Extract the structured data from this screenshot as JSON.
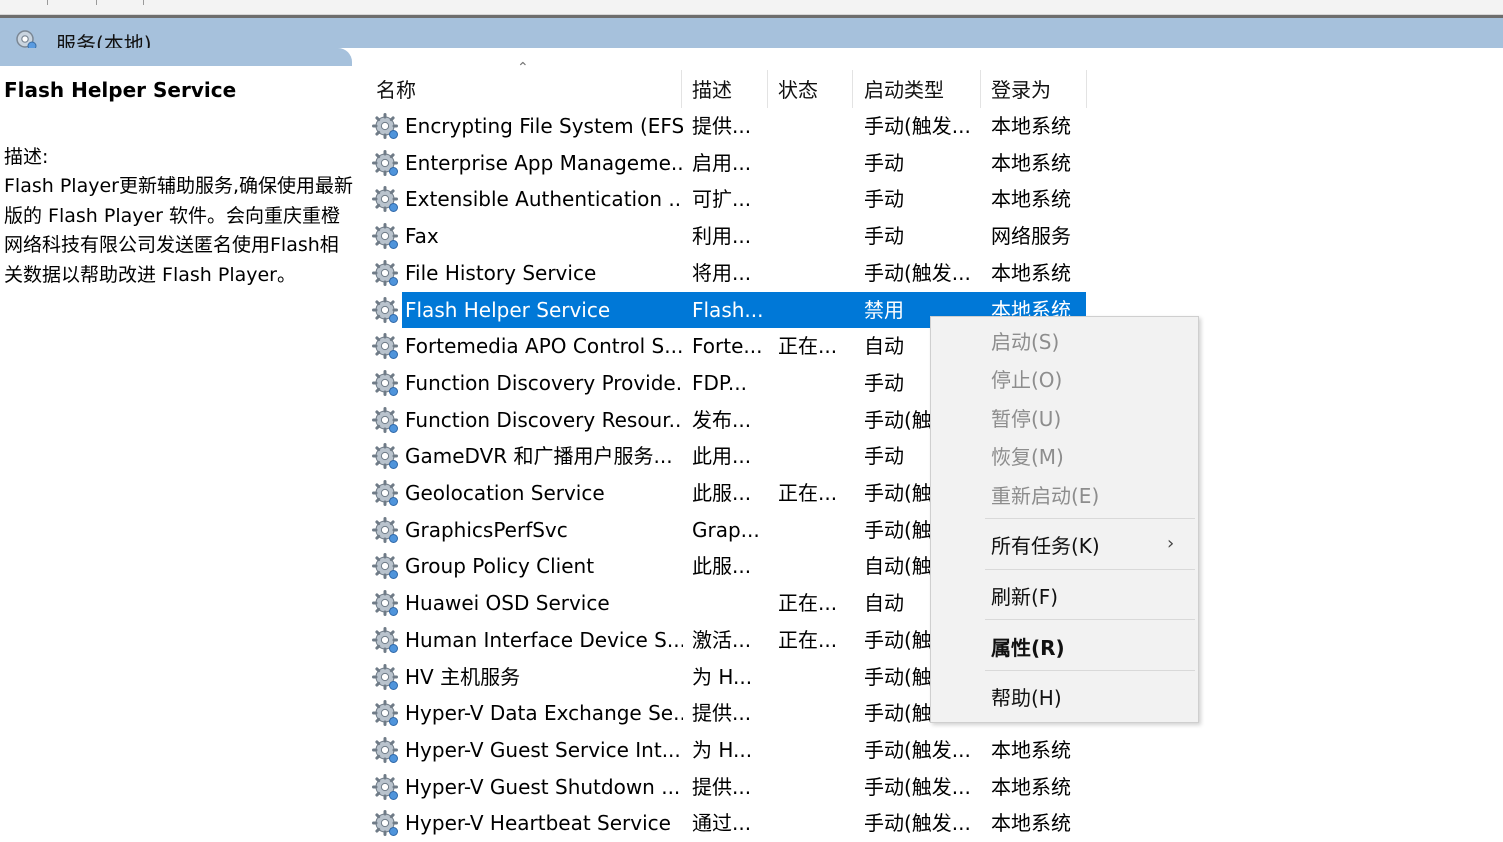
{
  "window": {
    "title": "服务(本地)"
  },
  "description_pane": {
    "service_name": "Flash Helper Service",
    "label": "描述:",
    "text": "Flash Player更新辅助服务,确保使用最新版的 Flash Player 软件。会向重庆重橙网络科技有限公司发送匿名使用Flash相关数据以帮助改进 Flash Player。"
  },
  "columns": {
    "name": "名称",
    "description": "描述",
    "status": "状态",
    "startup": "启动类型",
    "logon": "登录为"
  },
  "rows": [
    {
      "name": "Encrypting File System (EFS)",
      "desc": "提供...",
      "status": "",
      "startup": "手动(触发...",
      "logon": "本地系统"
    },
    {
      "name": "Enterprise App Manageme...",
      "desc": "启用...",
      "status": "",
      "startup": "手动",
      "logon": "本地系统"
    },
    {
      "name": "Extensible Authentication ...",
      "desc": "可扩...",
      "status": "",
      "startup": "手动",
      "logon": "本地系统"
    },
    {
      "name": "Fax",
      "desc": "利用...",
      "status": "",
      "startup": "手动",
      "logon": "网络服务"
    },
    {
      "name": "File History Service",
      "desc": "将用...",
      "status": "",
      "startup": "手动(触发...",
      "logon": "本地系统"
    },
    {
      "name": "Flash Helper Service",
      "desc": "Flash...",
      "status": "",
      "startup": "禁用",
      "logon": "本地系统",
      "selected": true
    },
    {
      "name": "Fortemedia APO Control S...",
      "desc": "Forte...",
      "status": "正在...",
      "startup": "自动",
      "logon": ""
    },
    {
      "name": "Function Discovery Provide...",
      "desc": "FDP...",
      "status": "",
      "startup": "手动",
      "logon": ""
    },
    {
      "name": "Function Discovery Resour...",
      "desc": "发布...",
      "status": "",
      "startup": "手动(触",
      "logon": ""
    },
    {
      "name": "GameDVR 和广播用户服务...",
      "desc": "此用...",
      "status": "",
      "startup": "手动",
      "logon": ""
    },
    {
      "name": "Geolocation Service",
      "desc": "此服...",
      "status": "正在...",
      "startup": "手动(触",
      "logon": ""
    },
    {
      "name": "GraphicsPerfSvc",
      "desc": "Grap...",
      "status": "",
      "startup": "手动(触",
      "logon": ""
    },
    {
      "name": "Group Policy Client",
      "desc": "此服...",
      "status": "",
      "startup": "自动(触",
      "logon": ""
    },
    {
      "name": "Huawei OSD Service",
      "desc": "",
      "status": "正在...",
      "startup": "自动",
      "logon": ""
    },
    {
      "name": "Human Interface Device S...",
      "desc": "激活...",
      "status": "正在...",
      "startup": "手动(触",
      "logon": ""
    },
    {
      "name": "HV 主机服务",
      "desc": "为 H...",
      "status": "",
      "startup": "手动(触",
      "logon": ""
    },
    {
      "name": "Hyper-V Data Exchange Se...",
      "desc": "提供...",
      "status": "",
      "startup": "手动(触",
      "logon": ""
    },
    {
      "name": "Hyper-V Guest Service Int...",
      "desc": "为 H...",
      "status": "",
      "startup": "手动(触发...",
      "logon": "本地系统"
    },
    {
      "name": "Hyper-V Guest Shutdown ...",
      "desc": "提供...",
      "status": "",
      "startup": "手动(触发...",
      "logon": "本地系统"
    },
    {
      "name": "Hyper-V Heartbeat Service",
      "desc": "通过...",
      "status": "",
      "startup": "手动(触发...",
      "logon": "本地系统"
    }
  ],
  "context_menu": {
    "start": "启动(S)",
    "stop": "停止(O)",
    "pause": "暂停(U)",
    "resume": "恢复(M)",
    "restart": "重新启动(E)",
    "all_tasks": "所有任务(K)",
    "refresh": "刷新(F)",
    "properties": "属性(R)",
    "help": "帮助(H)",
    "submenu_arrow": "›"
  },
  "colors": {
    "header": "#a6c1dc",
    "selection": "#0078d7"
  },
  "icons": {
    "header": "services-gear-icon",
    "row": "service-gear-icon"
  }
}
